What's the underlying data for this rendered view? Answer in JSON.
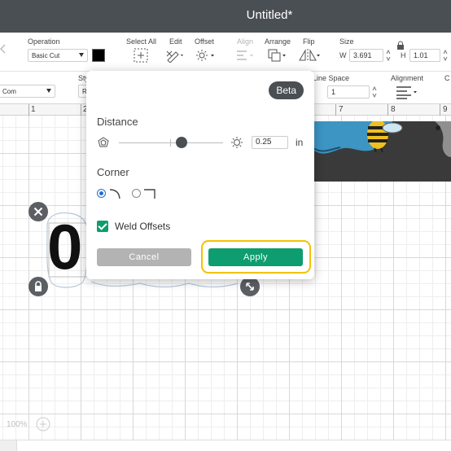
{
  "window": {
    "title": "Untitled*"
  },
  "toolbar": {
    "operation_label": "Operation",
    "operation_value": "Basic Cut",
    "select_all_label": "Select All",
    "edit_label": "Edit",
    "offset_label": "Offset",
    "align_label": "Align",
    "arrange_label": "Arrange",
    "flip_label": "Flip",
    "size_label": "Size",
    "width_prefix": "W",
    "width_value": "3.691",
    "height_prefix": "H",
    "height_value": "1.01",
    "color_swatch": "#000000"
  },
  "toolbar2": {
    "font_value": "Com",
    "style_label": "Sty",
    "style_value": "R",
    "line_space_label": "Line Space",
    "line_space_value": "1",
    "alignment_label": "Alignment",
    "partial_right_label": "C"
  },
  "ruler": {
    "numbers": [
      "1",
      "2",
      "7",
      "8",
      "9"
    ]
  },
  "canvas": {
    "text_glyph": "0",
    "zoom_value": "100%"
  },
  "popup": {
    "beta_label": "Beta",
    "distance_label": "Distance",
    "distance_value": "0.25",
    "distance_unit": "in",
    "slider_level_fraction": 0.6,
    "corner_label": "Corner",
    "corner_options": [
      "rounded",
      "square"
    ],
    "corner_selected": "rounded",
    "weld_label": "Weld Offsets",
    "weld_checked": true,
    "cancel_label": "Cancel",
    "apply_label": "Apply"
  },
  "colors": {
    "titlebar": "#4a4f54",
    "apply_button": "#0e9d6e",
    "cancel_button": "#b3b3b3",
    "highlight": "#f2c200",
    "radio_selected": "#1e6fd6"
  }
}
